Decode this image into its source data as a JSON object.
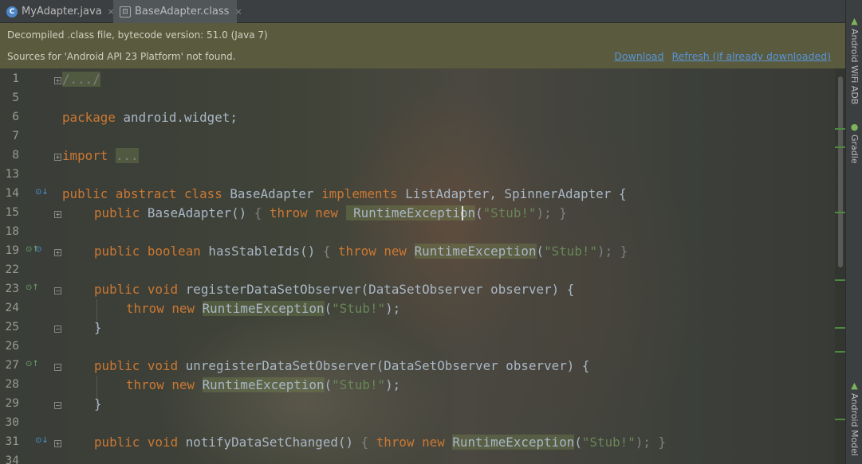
{
  "tabs": [
    {
      "label": "MyAdapter.java",
      "icon": "java-class-icon",
      "close": "×"
    },
    {
      "label": "BaseAdapter.class",
      "icon": "class-file-icon",
      "close": "×"
    }
  ],
  "banner": {
    "line1": "Decompiled .class file, bytecode version: 51.0 (Java 7)",
    "line2": "Sources for 'Android API 23 Platform' not found.",
    "download": "Download",
    "refresh": "Refresh (if already downloaded)"
  },
  "line_numbers": [
    "1",
    "5",
    "6",
    "7",
    "8",
    "13",
    "14",
    "15",
    "18",
    "19",
    "22",
    "23",
    "24",
    "25",
    "26",
    "27",
    "28",
    "29",
    "30",
    "31",
    "34"
  ],
  "code": {
    "l1": "/.../",
    "l6_kw": "package",
    "l6_rest": " android.widget;",
    "l8_kw": "import",
    "l8_fold": "...",
    "l14_kw1": "public abstract class",
    "l14_name": " BaseAdapter ",
    "l14_kw2": "implements",
    "l14_rest": " ListAdapter, SpinnerAdapter {",
    "l15_kw": "public",
    "l15_a": " BaseAdapter() ",
    "l15_b": "{ ",
    "l15_kw2": "throw new",
    "l15_exc": " RuntimeException",
    "l15_c": "(",
    "l15_str": "\"Stub!\"",
    "l15_d": "); }",
    "l19_kw": "public boolean",
    "l19_a": " hasStableIds() ",
    "l19_b": "{ ",
    "l19_kw2": "throw new",
    "l19_exc": "RuntimeException",
    "l19_c": "(",
    "l19_str": "\"Stub!\"",
    "l19_d": "); }",
    "l23_kw": "public void",
    "l23_rest": " registerDataSetObserver(DataSetObserver observer) {",
    "l24_kw": "throw new",
    "l24_exc": "RuntimeException",
    "l24_c": "(",
    "l24_str": "\"Stub!\"",
    "l24_d": ");",
    "l25": "}",
    "l27_kw": "public void",
    "l27_rest": " unregisterDataSetObserver(DataSetObserver observer) {",
    "l28_kw": "throw new",
    "l28_exc": "RuntimeException",
    "l28_c": "(",
    "l28_str": "\"Stub!\"",
    "l28_d": ");",
    "l29": "}",
    "l31_kw": "public void",
    "l31_a": " notifyDataSetChanged() ",
    "l31_b": "{ ",
    "l31_kw2": "throw new",
    "l31_exc": "RuntimeException",
    "l31_c": "(",
    "l31_str": "\"Stub!\"",
    "l31_d": "); }"
  },
  "right_tools": [
    {
      "label": "Android WiFi ADB",
      "icon": "android-icon"
    },
    {
      "label": "Gradle",
      "icon": "gradle-icon"
    },
    {
      "label": "Android Model",
      "icon": "android-icon"
    }
  ],
  "colors": {
    "keyword": "#cc7832",
    "string": "#6a8759",
    "identifier": "#a9b7c6",
    "link": "#5894d8",
    "banner_bg": "#5a5a3e"
  }
}
